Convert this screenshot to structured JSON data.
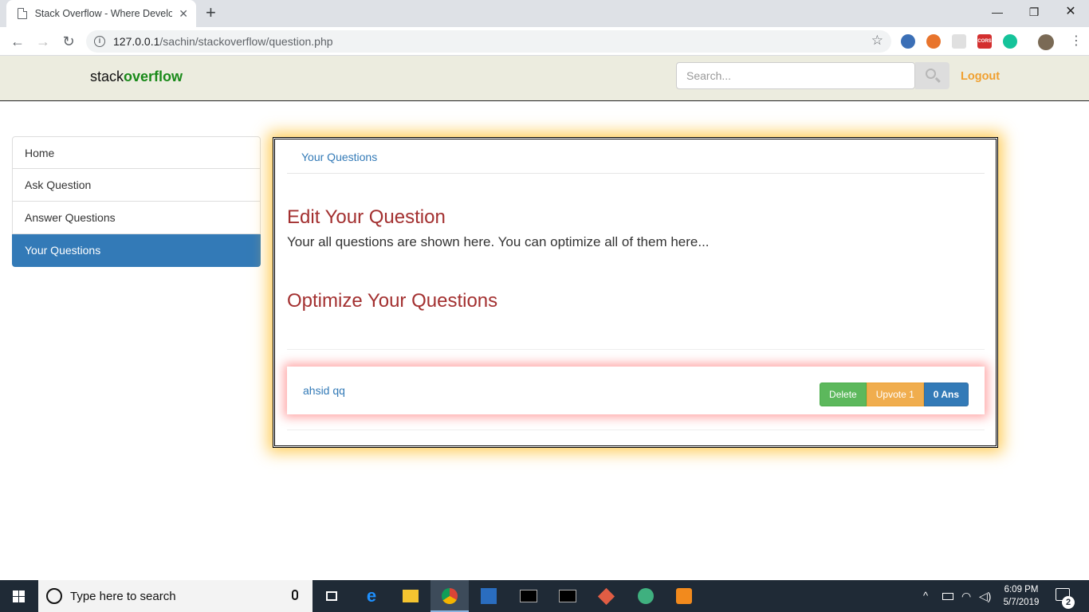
{
  "browser": {
    "tab_title": "Stack Overflow - Where Developers Learn",
    "tab_close": "✕",
    "new_tab": "+",
    "window_controls": {
      "minimize": "—",
      "restore": "❐",
      "close": "✕"
    },
    "nav": {
      "back": "←",
      "forward": "→",
      "reload": "↻"
    },
    "url_host": "127.0.0.1",
    "url_path": "/sachin/stackoverflow/question.php",
    "bookmark_star": "☆",
    "extensions": [
      {
        "name": "extension-1",
        "color": "#3b6fb6"
      },
      {
        "name": "extension-2",
        "color": "#e8742c"
      },
      {
        "name": "extension-3",
        "color": "#cccccc"
      },
      {
        "name": "cors-extension",
        "color": "#d32f2f",
        "label": "CORS"
      },
      {
        "name": "grammarly-extension",
        "color": "#15c39a"
      },
      {
        "name": "profile-avatar",
        "color": "#7a6a55"
      }
    ]
  },
  "site": {
    "brand_prefix": "stack",
    "brand_accent": "overflow",
    "search_placeholder": "Search...",
    "logout_label": "Logout"
  },
  "sidebar": {
    "items": [
      {
        "label": "Home",
        "active": false
      },
      {
        "label": "Ask Question",
        "active": false
      },
      {
        "label": "Answer Questions",
        "active": false
      },
      {
        "label": "Your Questions",
        "active": true
      }
    ]
  },
  "main": {
    "tab_label": "Your Questions",
    "edit_heading": "Edit Your Question",
    "description": "Your all questions are shown here. You can optimize all of them here...",
    "optimize_heading": "Optimize Your Questions",
    "questions": [
      {
        "title": "ahsid qq",
        "delete_label": "Delete",
        "upvote_label": "Upvote 1",
        "answers_label": "0 Ans"
      }
    ]
  },
  "taskbar": {
    "search_placeholder": "Type here to search",
    "time": "6:09 PM",
    "date": "5/7/2019",
    "notification_count": "2",
    "tray_chevron": "^"
  },
  "colors": {
    "primary": "#337ab7",
    "heading": "#a33030",
    "brand_green": "#1a8a1a",
    "logout": "#f0a030",
    "success": "#5cb85c",
    "warning": "#f0ad4e"
  }
}
